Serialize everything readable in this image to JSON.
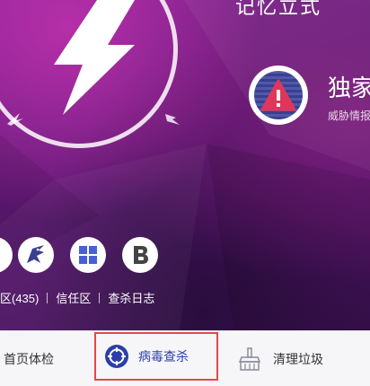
{
  "hero": {
    "top_text": "记忆立式",
    "promo": {
      "title": "独家",
      "subtitle": "威胁情报"
    }
  },
  "quick_actions": [
    {
      "icon": "eagle-icon"
    },
    {
      "icon": "windows-icon"
    },
    {
      "icon": "b-letter-icon"
    }
  ],
  "links": {
    "quarantine": "区(435)",
    "trust_zone": "信任区",
    "scan_log": "查杀日志"
  },
  "tabs": {
    "home_check": "首页体检",
    "virus_scan": "病毒查杀",
    "cleanup": "清理垃圾"
  },
  "colors": {
    "accent_red": "#e5474b",
    "tab_icon_blue": "#2e3ea8"
  }
}
